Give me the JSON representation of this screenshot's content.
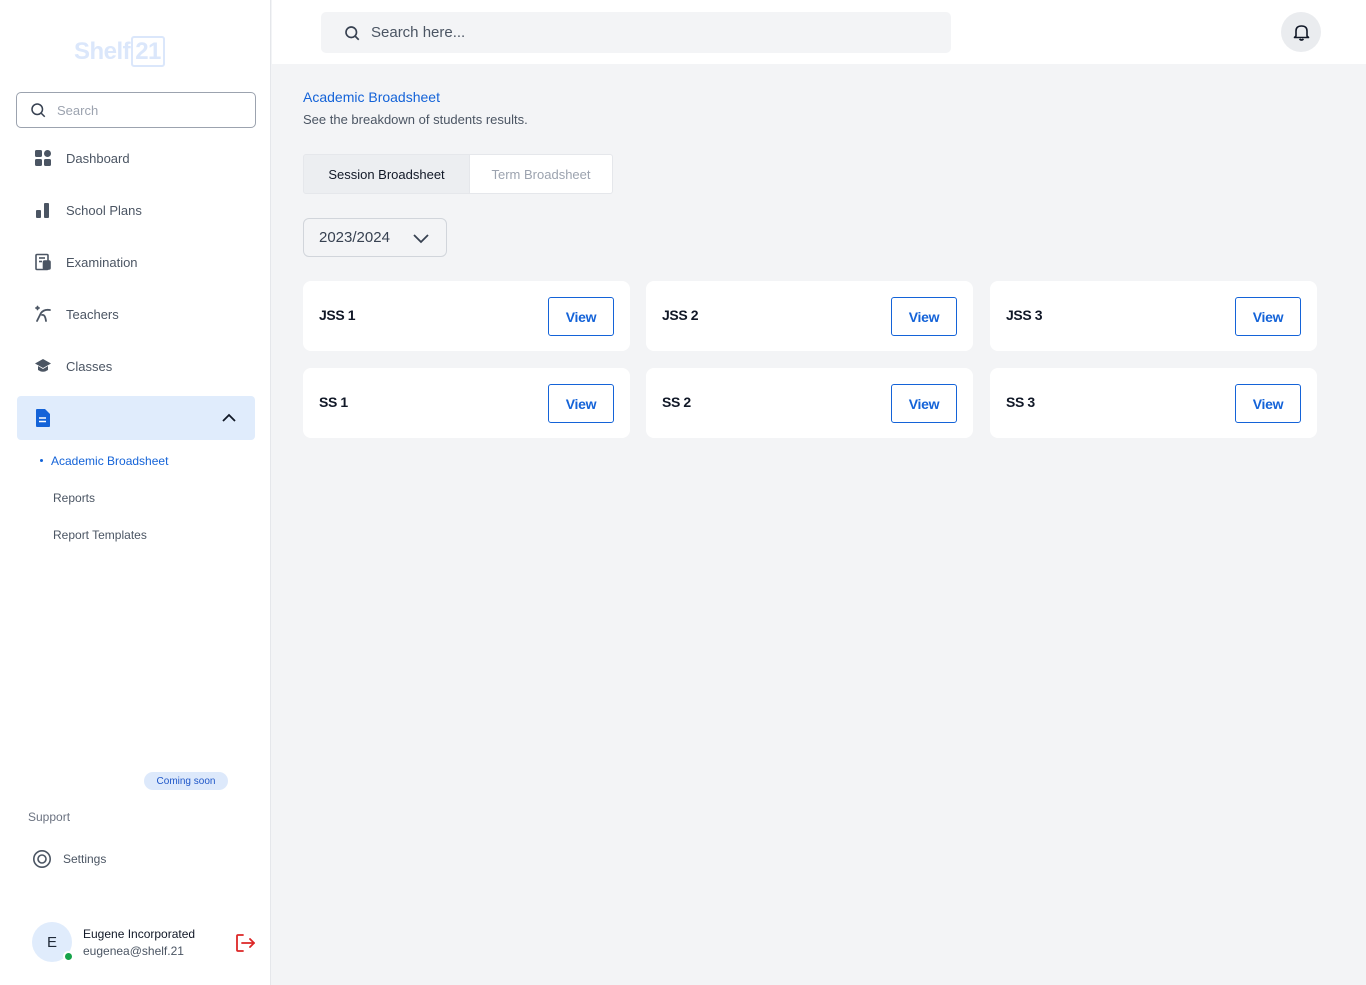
{
  "brand": {
    "name": "Shelf",
    "number": "21"
  },
  "sidebar": {
    "search_placeholder": "Search",
    "items": [
      {
        "label": "Dashboard",
        "icon": "dashboard-icon"
      },
      {
        "label": "School Plans",
        "icon": "bar-chart-icon"
      },
      {
        "label": "Examination",
        "icon": "exam-icon"
      },
      {
        "label": "Teachers",
        "icon": "teachers-icon"
      },
      {
        "label": "Classes",
        "icon": "graduation-cap-icon"
      }
    ],
    "expanded_section": {
      "icon": "document-icon",
      "subitems": [
        {
          "label": "Academic Broadsheet",
          "active": true
        },
        {
          "label": "Reports"
        },
        {
          "label": "Report Templates"
        }
      ]
    },
    "coming_soon": "Coming soon",
    "support_label": "Support",
    "settings_label": "Settings",
    "user": {
      "initial": "E",
      "name": "Eugene Incorporated",
      "email": "eugenea@shelf.21"
    }
  },
  "topbar": {
    "search_placeholder": "Search here..."
  },
  "main": {
    "breadcrumb": "Academic Broadsheet",
    "subtitle": "See the breakdown of students results.",
    "tabs": [
      {
        "label": "Session Broadsheet",
        "active": true
      },
      {
        "label": "Term Broadsheet",
        "active": false
      }
    ],
    "session_select": "2023/2024",
    "classes": [
      {
        "name": "JSS 1",
        "button": "View"
      },
      {
        "name": "JSS 2",
        "button": "View"
      },
      {
        "name": "JSS 3",
        "button": "View"
      },
      {
        "name": "SS 1",
        "button": "View"
      },
      {
        "name": "SS 2",
        "button": "View"
      },
      {
        "name": "SS 3",
        "button": "View"
      }
    ]
  },
  "colors": {
    "accent": "#1463d8",
    "active_bg": "#e0ecfc",
    "online": "#16a34a",
    "logout": "#dc2626"
  }
}
